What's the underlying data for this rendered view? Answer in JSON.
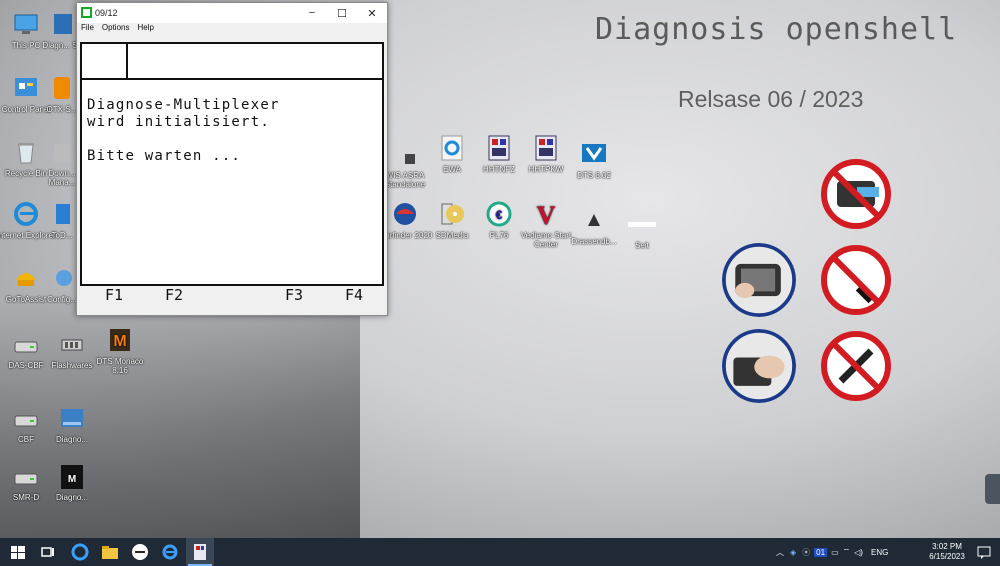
{
  "wallpaper": {
    "title": "Diagnosis openshell",
    "release": "Relsase   06 / 2023"
  },
  "desktop_icons": [
    {
      "label": "This PC",
      "icon": "pc-icon"
    },
    {
      "label": "Diagn... Sc",
      "icon": "diagnosis-icon"
    },
    {
      "label": "Control Panel",
      "icon": "control-panel-icon"
    },
    {
      "label": "OTX-S...",
      "icon": "otx-icon"
    },
    {
      "label": "Recycle Bin",
      "icon": "recycle-bin-icon"
    },
    {
      "label": "Down... Mana...",
      "icon": "download-manager-icon"
    },
    {
      "label": "Internet Explorer",
      "icon": "ie-icon"
    },
    {
      "label": "ToD...",
      "icon": "todo-icon"
    },
    {
      "label": "GoToAssist",
      "icon": "gotoassist-icon"
    },
    {
      "label": "Config...",
      "icon": "config-icon"
    },
    {
      "label": "DAS-CBF",
      "icon": "drive-icon"
    },
    {
      "label": "Flashwares",
      "icon": "flash-icon"
    },
    {
      "label": "DTS Monaco 8.16",
      "icon": "dts-monaco-icon"
    },
    {
      "label": "CBF",
      "icon": "drive-icon"
    },
    {
      "label": "Diagno...",
      "icon": "diagnosis-folder-icon"
    },
    {
      "label": "SMR-D",
      "icon": "drive-icon"
    },
    {
      "label": "Diagno...",
      "icon": "diagnosis-black-icon"
    },
    {
      "label": "WIS ASRA Standalone",
      "icon": "wis-icon"
    },
    {
      "label": "EWA",
      "icon": "ewa-icon"
    },
    {
      "label": "HHTNFZ",
      "icon": "hht-icon"
    },
    {
      "label": "HHTPKW",
      "icon": "hht-icon"
    },
    {
      "label": "DTS 8.02",
      "icon": "dts-icon"
    },
    {
      "label": "Starfinder 2020",
      "icon": "starfinder-icon"
    },
    {
      "label": "SDMedia",
      "icon": "sdmedia-icon"
    },
    {
      "label": "PL76",
      "icon": "pl76-icon"
    },
    {
      "label": "Vediamo Start Center",
      "icon": "vediamo-icon"
    },
    {
      "label": "Drassendb...",
      "icon": "database-icon"
    },
    {
      "label": "Seit",
      "icon": "blank-icon"
    }
  ],
  "window": {
    "title": "09/12",
    "menu": [
      "File",
      "Options",
      "Help"
    ],
    "controls": [
      "−",
      "☐",
      "✕"
    ],
    "screen_text_1": "Diagnose-Multiplexer\nwird initialisiert.",
    "screen_text_2": "Bitte warten ...",
    "fkeys": [
      "F1",
      "F2",
      "F3",
      "F4"
    ]
  },
  "taskbar": {
    "lang": "ENG",
    "time": "3:02 PM",
    "date": "6/15/2023",
    "tray_badge": "01"
  },
  "colors": {
    "accent": "#1f2a36",
    "sign_red": "#d21c22",
    "sign_blue": "#1b3a8a"
  }
}
